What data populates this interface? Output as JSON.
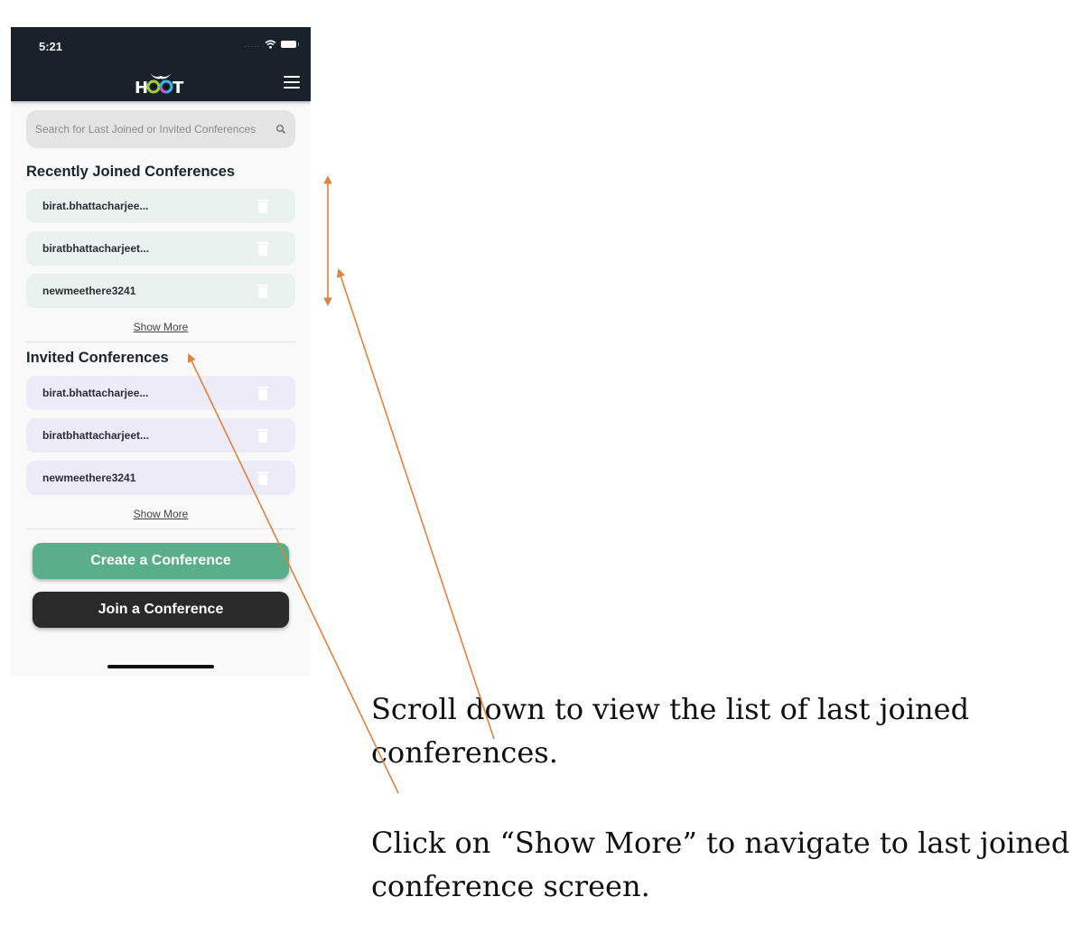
{
  "status_bar": {
    "time": "5:21",
    "signal": "....."
  },
  "header": {
    "logo_text": "HOOT",
    "menu_icon": "hamburger-menu-icon"
  },
  "search": {
    "placeholder": "Search for Last Joined or Invited Conferences",
    "icon": "search-icon"
  },
  "recent": {
    "title": "Recently Joined Conferences",
    "items": [
      {
        "label": "birat.bhattacharjee..."
      },
      {
        "label": "biratbhattacharjeet..."
      },
      {
        "label": "newmeethere3241"
      }
    ],
    "show_more": "Show More"
  },
  "invited": {
    "title": "Invited Conferences",
    "items": [
      {
        "label": "birat.bhattacharjee..."
      },
      {
        "label": "biratbhattacharjeet..."
      },
      {
        "label": "newmeethere3241"
      }
    ],
    "show_more": "Show More"
  },
  "actions": {
    "create": "Create a Conference",
    "join": "Join a Conference"
  },
  "annotations": {
    "scroll_note": "Scroll down to view the list of last joined conferences.",
    "show_more_note": "Click on “Show More” to navigate to last joined conference screen."
  },
  "colors": {
    "header_bg": "#19212a",
    "recent_row_bg": "#e9f2ee",
    "invited_row_bg": "#eeebf9",
    "create_button": "#5aae89",
    "join_button": "#2a2a2a",
    "annotation_arrow": "#e0823f"
  }
}
